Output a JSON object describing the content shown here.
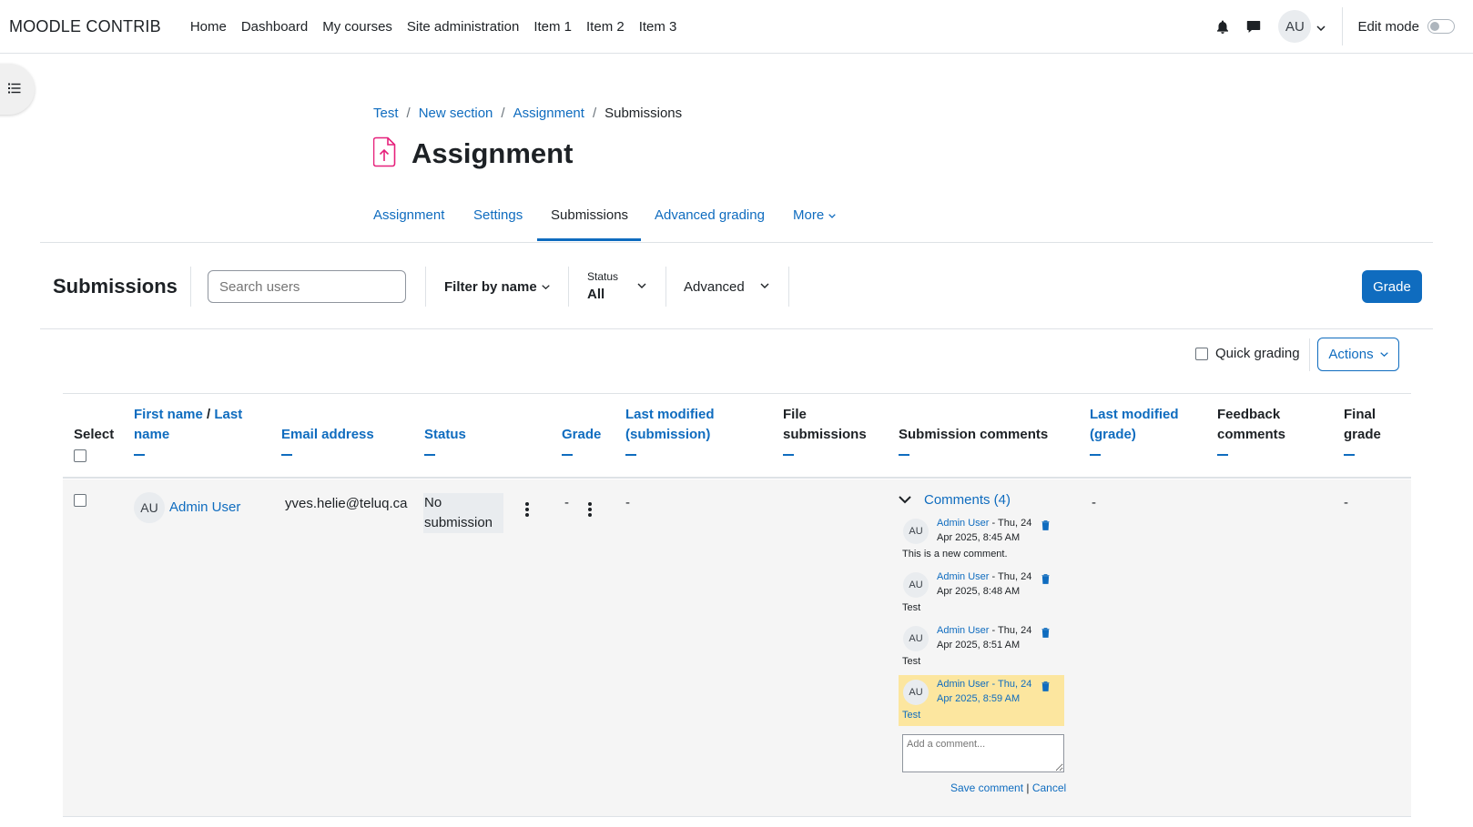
{
  "navbar": {
    "brand": "MOODLE CONTRIB",
    "items": [
      "Home",
      "Dashboard",
      "My courses",
      "Site administration",
      "Item 1",
      "Item 2",
      "Item 3"
    ],
    "avatar_initials": "AU",
    "edit_mode_label": "Edit mode"
  },
  "breadcrumb": [
    "Test",
    "New section",
    "Assignment",
    "Submissions"
  ],
  "page": {
    "title": "Assignment",
    "icon_color": "#e6217b"
  },
  "tabs": [
    "Assignment",
    "Settings",
    "Submissions",
    "Advanced grading",
    "More"
  ],
  "toolbar": {
    "title": "Submissions",
    "search_placeholder": "Search users",
    "filter_by_name": "Filter by name",
    "status_label": "Status",
    "status_value": "All",
    "advanced": "Advanced",
    "grade_button": "Grade",
    "quick_grading": "Quick grading",
    "actions": "Actions"
  },
  "table": {
    "headers": {
      "select": "Select",
      "first_name": "First name",
      "slash": " / ",
      "last_name": "Last name",
      "email": "Email address",
      "status": "Status",
      "grade": "Grade",
      "last_modified_submission": "Last modified (submission)",
      "file_submissions": "File submissions",
      "submission_comments": "Submission comments",
      "last_modified_grade": "Last modified (grade)",
      "feedback_comments": "Feedback comments",
      "final_grade": "Final grade"
    },
    "row": {
      "initials": "AU",
      "name": "Admin User",
      "email": "yves.helie@teluq.ca",
      "status": "No submission",
      "grade": "-",
      "last_modified_submission": "-",
      "last_modified_grade": "-",
      "final_grade": "-",
      "comments_label": "Comments (4)",
      "comments": [
        {
          "initials": "AU",
          "author": "Admin User",
          "date": " - Thu, 24 Apr 2025, 8:45 AM",
          "text": "This is a new comment."
        },
        {
          "initials": "AU",
          "author": "Admin User",
          "date": " - Thu, 24 Apr 2025, 8:48 AM",
          "text": "Test"
        },
        {
          "initials": "AU",
          "author": "Admin User",
          "date": " - Thu, 24 Apr 2025, 8:51 AM",
          "text": "Test"
        },
        {
          "initials": "AU",
          "author": "Admin User",
          "date": " - Thu, 24 Apr 2025, 8:59 AM",
          "text": "Test"
        }
      ],
      "add_comment_placeholder": "Add a comment...",
      "save_comment": "Save comment",
      "link_sep": " | ",
      "cancel": "Cancel"
    }
  },
  "colors": {
    "link": "#0f6cbf",
    "highlight": "#fce69f",
    "primary": "#0f6cbf"
  }
}
